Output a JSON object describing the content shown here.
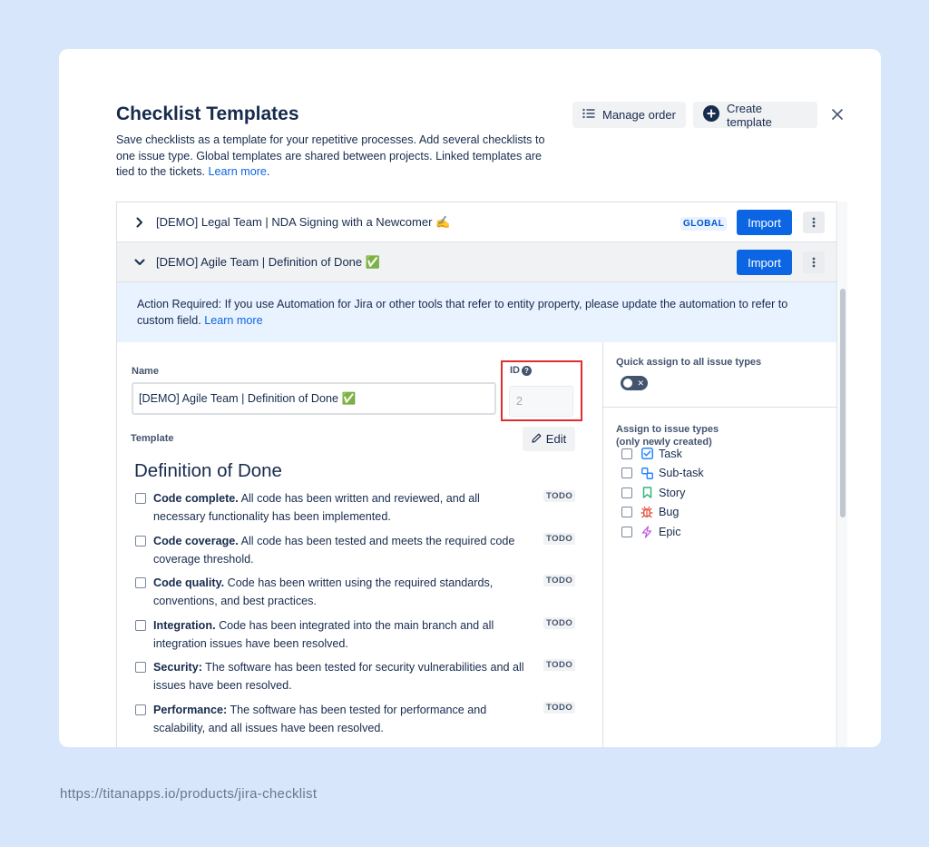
{
  "modal": {
    "title": "Checklist Templates",
    "description": "Save checklists as a template for your repetitive processes. Add several checklists to one issue type. Global templates are shared between projects. Linked templates are tied to the tickets. ",
    "learn_more": "Learn more",
    "manage_order_label": "Manage order",
    "create_template_label": "Create template"
  },
  "templates": [
    {
      "title": "[DEMO] Legal Team | NDA Signing with a Newcomer ✍️",
      "badge": "GLOBAL",
      "import_label": "Import",
      "expanded": false
    },
    {
      "title": "[DEMO] Agile Team | Definition of Done ✅",
      "import_label": "Import",
      "expanded": true
    }
  ],
  "alert": {
    "text": "Action Required: If you use Automation for Jira or other tools that refer to entity property, please update the automation to refer to custom field. ",
    "link": "Learn more"
  },
  "form": {
    "name_label": "Name",
    "name_value": "[DEMO] Agile Team | Definition of Done ✅",
    "id_label": "ID",
    "id_value": "2",
    "template_label": "Template",
    "edit_label": "Edit"
  },
  "checklist": {
    "heading": "Definition of Done",
    "items": [
      {
        "bold": "Code complete.",
        "text": " All code has been written and reviewed, and all necessary functionality has been implemented.",
        "status": "TODO"
      },
      {
        "bold": "Code coverage.",
        "text": " All code has been tested and meets the required code coverage threshold.",
        "status": "TODO"
      },
      {
        "bold": "Code quality.",
        "text": " Code has been written using the required standards, conventions, and best practices.",
        "status": "TODO"
      },
      {
        "bold": "Integration.",
        "text": " Code has been integrated into the main branch and all integration issues have been resolved.",
        "status": "TODO"
      },
      {
        "bold": "Security:",
        "text": " The software has been tested for security vulnerabilities and all issues have been resolved.",
        "status": "TODO"
      },
      {
        "bold": "Performance:",
        "text": " The software has been tested for performance and scalability, and all issues have been resolved.",
        "status": "TODO"
      }
    ]
  },
  "sidebar": {
    "quick_assign_label": "Quick assign to all issue types",
    "toggle_symbol": "✕",
    "assign_label_line1": "Assign to issue types",
    "assign_label_line2": "(only newly created)",
    "issue_types": [
      {
        "label": "Task",
        "icon": "task-icon",
        "color": "#2684ff"
      },
      {
        "label": "Sub-task",
        "icon": "subtask-icon",
        "color": "#2684ff"
      },
      {
        "label": "Story",
        "icon": "story-icon",
        "color": "#36b37e"
      },
      {
        "label": "Bug",
        "icon": "bug-icon",
        "color": "#e34935"
      },
      {
        "label": "Epic",
        "icon": "epic-icon",
        "color": "#c25cdb"
      }
    ]
  },
  "footer": {
    "url": "https://titanapps.io/products/jira-checklist"
  },
  "colors": {
    "primary": "#0c66e4",
    "highlight_border": "#e12d2d",
    "page_bg": "#d7e6fa"
  }
}
